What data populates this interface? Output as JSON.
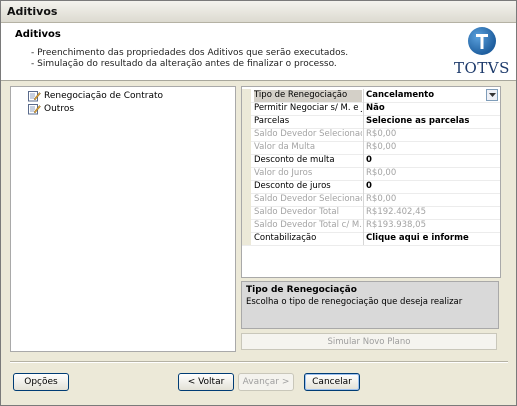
{
  "window": {
    "title": "Aditivos"
  },
  "header": {
    "title": "Aditivos",
    "lines": [
      "- Preenchimento das propriedades dos Aditivos que serão executados.",
      "- Simulação do resultado da alteração antes de finalizar o processo."
    ],
    "logo_text": "TOTVS"
  },
  "tree": {
    "items": [
      {
        "label": "Renegociação de Contrato",
        "icon": "edit-icon"
      },
      {
        "label": "Outros",
        "icon": "edit-icon"
      }
    ]
  },
  "properties": [
    {
      "label": "Tipo de Renegociação",
      "value": "Cancelamento",
      "enabled": true,
      "bold": true,
      "selected": true
    },
    {
      "label": "Permitir Negociar s/ M. e J.",
      "value": "Não",
      "enabled": true,
      "bold": true
    },
    {
      "label": "Parcelas",
      "value": "Selecione as parcelas",
      "enabled": true,
      "bold": true
    },
    {
      "label": "Saldo Devedor Selecionado",
      "value": "R$0,00",
      "enabled": false
    },
    {
      "label": "Valor da Multa",
      "value": "R$0,00",
      "enabled": false
    },
    {
      "label": "Desconto de multa",
      "value": "0",
      "enabled": true,
      "bold": true
    },
    {
      "label": "Valor do Juros",
      "value": "R$0,00",
      "enabled": false
    },
    {
      "label": "Desconto de juros",
      "value": "0",
      "enabled": true,
      "bold": true
    },
    {
      "label": "Saldo Devedor Selecionado c/",
      "value": "R$0,00",
      "enabled": false
    },
    {
      "label": "Saldo Devedor Total",
      "value": "R$192.402,45",
      "enabled": false
    },
    {
      "label": "Saldo Devedor Total c/ M. e",
      "value": "R$193.938,05",
      "enabled": false
    },
    {
      "label": "Contabilização",
      "value": "Clique aqui e informe",
      "enabled": true,
      "bold": true
    }
  ],
  "help": {
    "title": "Tipo de Renegociação",
    "description": "Escolha o tipo de renegociação que deseja realizar"
  },
  "simulate_button": "Simular Novo Plano",
  "footer": {
    "options": "Opções",
    "back": "< Voltar",
    "next": "Avançar >",
    "cancel": "Cancelar"
  },
  "colors": {
    "accent": "#1f5f9f",
    "focus_border": "#003c74"
  }
}
